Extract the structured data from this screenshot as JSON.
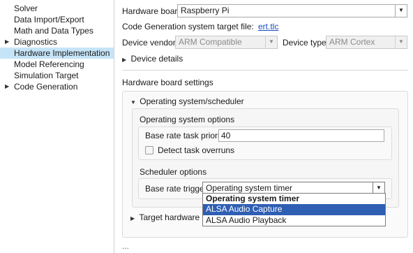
{
  "tree": {
    "items": [
      {
        "label": "Solver",
        "arrow": ""
      },
      {
        "label": "Data Import/Export",
        "arrow": ""
      },
      {
        "label": "Math and Data Types",
        "arrow": ""
      },
      {
        "label": "Diagnostics",
        "arrow": "▶"
      },
      {
        "label": "Hardware Implementation",
        "arrow": ""
      },
      {
        "label": "Model Referencing",
        "arrow": ""
      },
      {
        "label": "Simulation Target",
        "arrow": ""
      },
      {
        "label": "Code Generation",
        "arrow": "▶"
      }
    ],
    "selected_index": 4
  },
  "hardware": {
    "board_label": "Hardware board:",
    "board_value": "Raspberry Pi",
    "target_file_label": "Code Generation system target file:",
    "target_file_link": "ert.tlc",
    "device_vendor_label": "Device vendor:",
    "device_vendor_value": "ARM Compatible",
    "device_type_label": "Device type:",
    "device_type_value": "ARM Cortex",
    "device_details_label": "Device details"
  },
  "board_settings": {
    "title": "Hardware board settings",
    "os_scheduler_label": "Operating system/scheduler",
    "os_options_title": "Operating system options",
    "base_rate_priority_label": "Base rate task priority:",
    "base_rate_priority_value": "40",
    "detect_overruns_label": "Detect task overruns",
    "scheduler_options_title": "Scheduler options",
    "base_rate_trigger_label": "Base rate trigger:",
    "base_rate_trigger_value": "Operating system timer",
    "target_hw_label": "Target hardware reso",
    "ellipsis": "..."
  },
  "trigger_dropdown": {
    "options": [
      "Operating system timer",
      "ALSA Audio Capture",
      "ALSA Audio Playback"
    ],
    "highlighted_index": 1
  },
  "icons": {
    "expand": "triangle-right-icon",
    "collapse": "triangle-down-icon",
    "combo": "chevron-down-icon"
  },
  "colors": {
    "selection": "#c6e4f7",
    "highlight": "#2f5fb3",
    "link": "#1a4dc4"
  }
}
